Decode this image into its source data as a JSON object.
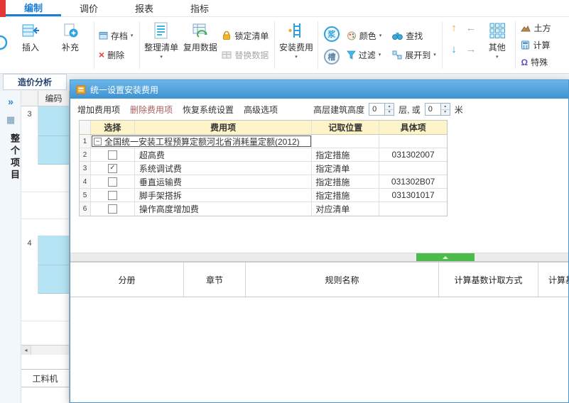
{
  "app": {
    "tabs": [
      {
        "label": "编制",
        "active": true
      },
      {
        "label": "调价",
        "active": false
      },
      {
        "label": "报表",
        "active": false
      },
      {
        "label": "指标",
        "active": false
      }
    ]
  },
  "ribbon": {
    "insert": "插入",
    "supplement": "补充",
    "archive": "存档",
    "delete": "删除",
    "organize_list": "整理清单",
    "reuse_data": "复用数据",
    "lock_list": "锁定清单",
    "replace_data": "替换数据",
    "install_fee": "安装费用",
    "circle_top": "浆",
    "circle_bottom": "槽",
    "color": "颜色",
    "find": "查找",
    "filter": "过滤",
    "expand_to": "展开到",
    "other": "其他",
    "earthwork": "土方",
    "calculator": "计算",
    "special": "特殊"
  },
  "left_panel": {
    "analysis_tab": "造价分析",
    "project_label": "整个项目",
    "grid_header": "编码",
    "row3": "3",
    "row4": "4",
    "bottom_tab": "工料机"
  },
  "dialog": {
    "title": "统一设置安装费用",
    "toolbar": {
      "add": "增加费用项",
      "remove": "删除费用项",
      "restore": "恢复系统设置",
      "advanced": "高级选项",
      "height_label": "高层建筑高度",
      "floors": "0",
      "floors_suffix": "层, 或",
      "meters": "0",
      "meters_suffix": "米"
    },
    "fee_table": {
      "headers": [
        "选择",
        "费用项",
        "记取位置",
        "具体项"
      ],
      "root": {
        "num": "1",
        "label": "全国统一安装工程预算定额河北省消耗量定额(2012)"
      },
      "rows": [
        {
          "num": "2",
          "check": "",
          "fee": "超高费",
          "position": "指定措施",
          "item": "031302007"
        },
        {
          "num": "3",
          "check": "✓",
          "fee": "系统调试费",
          "position": "指定清单",
          "item": ""
        },
        {
          "num": "4",
          "check": "",
          "fee": "垂直运输费",
          "position": "指定措施",
          "item": "031302B07"
        },
        {
          "num": "5",
          "check": "",
          "fee": "脚手架搭拆",
          "position": "指定措施",
          "item": "031301017"
        },
        {
          "num": "6",
          "check": "",
          "fee": "操作高度增加费",
          "position": "对应清单",
          "item": ""
        }
      ]
    },
    "rules_table": {
      "headers": [
        "分册",
        "章节",
        "规则名称",
        "计算基数计取方式",
        "计算基数"
      ]
    }
  },
  "icons": {
    "caret": "▾",
    "omega": "Ω",
    "chevrons": "»",
    "grid_small": "▦",
    "arrow_up": "↑",
    "arrow_left": "←",
    "arrow_down": "↓",
    "arrow_right": "→",
    "tree_collapse": "−",
    "scroll_left": "◂",
    "spin_up": "▲",
    "spin_down": "▼"
  },
  "colors": {
    "accent_blue": "#1a7fd4",
    "dialog_title_blue": "#3f93d2",
    "header_yellow": "#fdf5c9",
    "cell_cyan": "#b5e4f4",
    "splitter_green": "#4cbb4c",
    "corner_red": "#e53935"
  }
}
